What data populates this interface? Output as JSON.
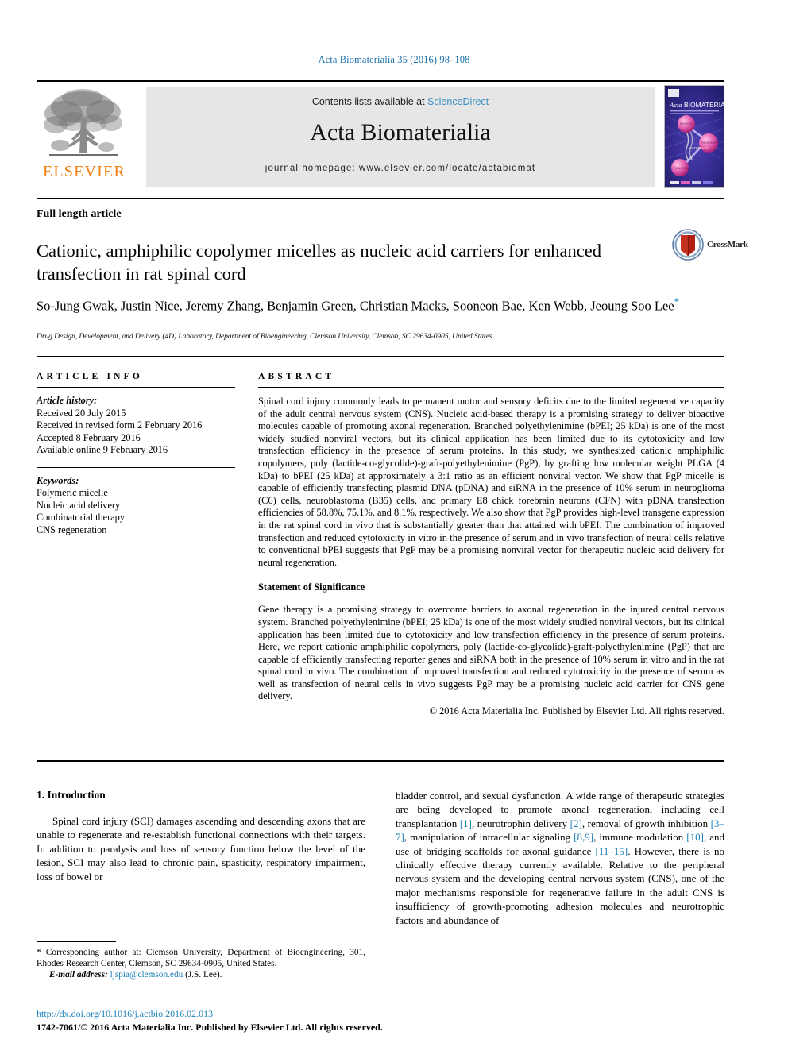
{
  "running_head": "Acta Biomaterialia 35 (2016) 98–108",
  "masthead": {
    "publisher_logo_name": "elsevier-tree-logo",
    "publisher_wordmark": "ELSEVIER",
    "contents_prefix": "Contents lists available at",
    "contents_link": "ScienceDirect",
    "journal_title": "Acta Biomaterialia",
    "homepage": "journal homepage: www.elsevier.com/locate/actabiomat",
    "cover_alt": "Acta Biomaterialia journal cover"
  },
  "article": {
    "type": "Full length article",
    "title": "Cationic, amphiphilic copolymer micelles as nucleic acid carriers for enhanced transfection in rat spinal cord",
    "crossmark_label": "CrossMark",
    "authors": "So-Jung Gwak, Justin Nice, Jeremy Zhang, Benjamin Green, Christian Macks, Sooneon Bae, Ken Webb, Jeoung Soo Lee",
    "corresponding_marker": "*",
    "affiliation": "Drug Design, Development, and Delivery (4D) Laboratory, Department of Bioengineering, Clemson University, Clemson, SC 29634-0905, United States"
  },
  "info": {
    "heading": "ARTICLE INFO",
    "history_label": "Article history:",
    "history": [
      "Received 20 July 2015",
      "Received in revised form 2 February 2016",
      "Accepted 8 February 2016",
      "Available online 9 February 2016"
    ],
    "keywords_label": "Keywords:",
    "keywords": [
      "Polymeric micelle",
      "Nucleic acid delivery",
      "Combinatorial therapy",
      "CNS regeneration"
    ]
  },
  "abstract": {
    "heading": "ABSTRACT",
    "text": "Spinal cord injury commonly leads to permanent motor and sensory deficits due to the limited regenerative capacity of the adult central nervous system (CNS). Nucleic acid-based therapy is a promising strategy to deliver bioactive molecules capable of promoting axonal regeneration. Branched polyethylenimine (bPEI; 25 kDa) is one of the most widely studied nonviral vectors, but its clinical application has been limited due to its cytotoxicity and low transfection efficiency in the presence of serum proteins. In this study, we synthesized cationic amphiphilic copolymers, poly (lactide-co-glycolide)-graft-polyethylenimine (PgP), by grafting low molecular weight PLGA (4 kDa) to bPEI (25 kDa) at approximately a 3:1 ratio as an efficient nonviral vector. We show that PgP micelle is capable of efficiently transfecting plasmid DNA (pDNA) and siRNA in the presence of 10% serum in neuroglioma (C6) cells, neuroblastoma (B35) cells, and primary E8 chick forebrain neurons (CFN) with pDNA transfection efficiencies of 58.8%, 75.1%, and 8.1%, respectively. We also show that PgP provides high-level transgene expression in the rat spinal cord in vivo that is substantially greater than that attained with bPEI. The combination of improved transfection and reduced cytotoxicity in vitro in the presence of serum and in vivo transfection of neural cells relative to conventional bPEI suggests that PgP may be a promising nonviral vector for therapeutic nucleic acid delivery for neural regeneration.",
    "significance_heading": "Statement of Significance",
    "significance_text": "Gene therapy is a promising strategy to overcome barriers to axonal regeneration in the injured central nervous system. Branched polyethylenimine (bPEI; 25 kDa) is one of the most widely studied nonviral vectors, but its clinical application has been limited due to cytotoxicity and low transfection efficiency in the presence of serum proteins. Here, we report cationic amphiphilic copolymers, poly (lactide-co-glycolide)-graft-polyethylenimine (PgP) that are capable of efficiently transfecting reporter genes and siRNA both in the presence of 10% serum in vitro and in the rat spinal cord in vivo. The combination of improved transfection and reduced cytotoxicity in the presence of serum as well as transfection of neural cells in vivo suggests PgP may be a promising nucleic acid carrier for CNS gene delivery.",
    "copyright": "© 2016 Acta Materialia Inc. Published by Elsevier Ltd. All rights reserved."
  },
  "body": {
    "section_number_title": "1. Introduction",
    "left_paragraph": "Spinal cord injury (SCI) damages ascending and descending axons that are unable to regenerate and re-establish functional connections with their targets. In addition to paralysis and loss of sensory function below the level of the lesion, SCI may also lead to chronic pain, spasticity, respiratory impairment, loss of bowel or",
    "right_paragraph_parts": [
      "bladder control, and sexual dysfunction. A wide range of therapeutic strategies are being developed to promote axonal regeneration, including cell transplantation ",
      "[1]",
      ", neurotrophin delivery ",
      "[2]",
      ", removal of growth inhibition ",
      "[3–7]",
      ", manipulation of intracellular signaling ",
      "[8,9]",
      ", immune modulation ",
      "[10]",
      ", and use of bridging scaffolds for axonal guidance ",
      "[11–15]",
      ". However, there is no clinically effective therapy currently available. Relative to the peripheral nervous system and the developing central nervous system (CNS), one of the major mechanisms responsible for regenerative failure in the adult CNS is insufficiency of growth-promoting adhesion molecules and neurotrophic factors and abundance of"
    ]
  },
  "footer": {
    "corresponding_marker": "*",
    "corresponding_text": "Corresponding author at: Clemson University, Department of Bioengineering, 301, Rhodes Research Center, Clemson, SC 29634-0905, United States.",
    "email_label": "E-mail address:",
    "email": "ljspia@clemson.edu",
    "email_suffix": "(J.S. Lee).",
    "doi": "http://dx.doi.org/10.1016/j.actbio.2016.02.013",
    "issn_line": "1742-7061/© 2016 Acta Materialia Inc. Published by Elsevier Ltd. All rights reserved."
  },
  "colors": {
    "link": "#1a7fb8",
    "sciencedirect": "#3a8fc4",
    "elsevier_orange": "#F07F13",
    "band_gray": "#e6e6e6"
  }
}
